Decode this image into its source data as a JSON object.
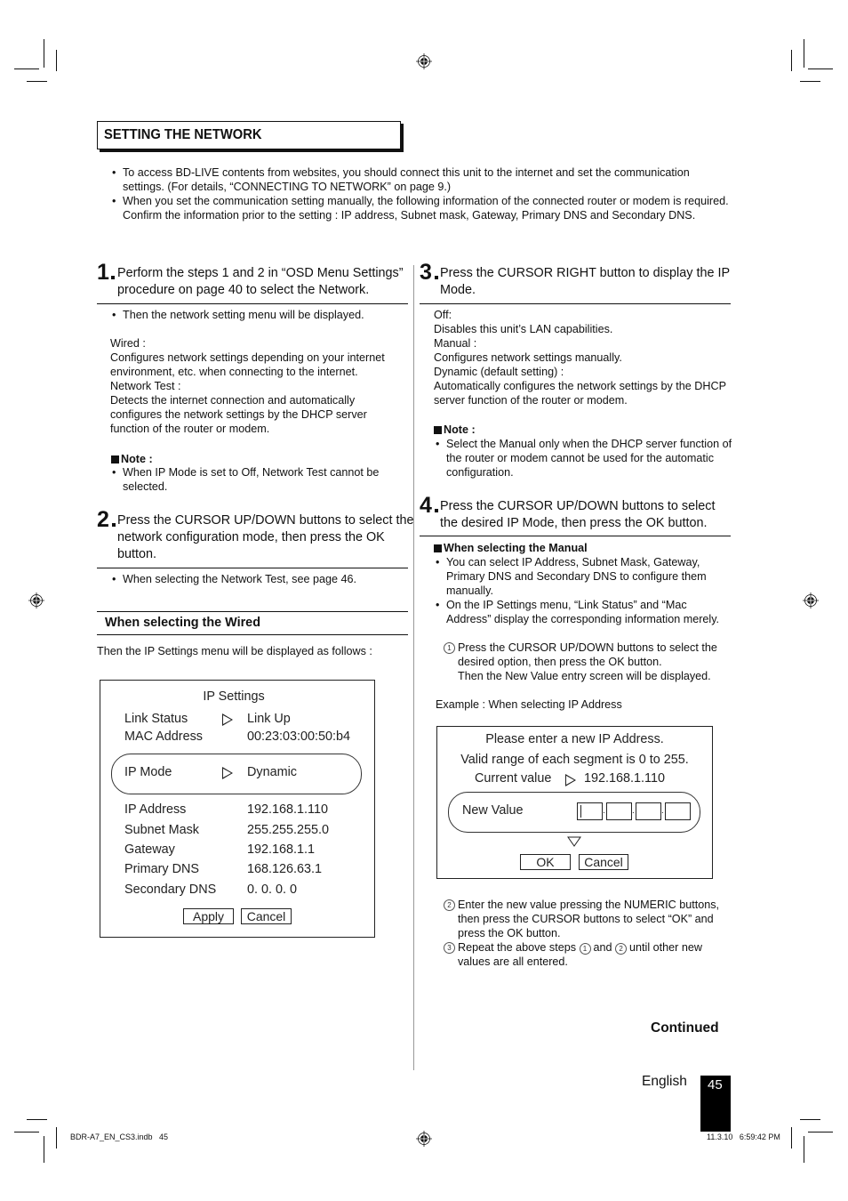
{
  "header": {
    "section_title": "SETTING THE NETWORK"
  },
  "intro": {
    "bullets": [
      "To access BD-LIVE contents from websites, you should connect this unit to the internet and set the communication settings. (For details, “CONNECTING TO NETWORK” on page 9.)",
      "When you set the communication setting manually, the following information of the connected router or modem is required. Confirm the information prior to the setting : IP address, Subnet mask, Gateway, Primary DNS and Secondary DNS."
    ]
  },
  "left_column": {
    "step1": {
      "number": "1",
      "text": "Perform the steps 1 and 2 in “OSD Menu Settings” procedure on page 40 to select the Network.",
      "bullet": "Then the network setting menu will be displayed.",
      "details": [
        "Wired :",
        "Configures network settings depending on your internet environment, etc. when connecting to the internet.",
        "Network Test :",
        "Detects the internet connection and automatically configures the network settings by the DHCP server function of the router or modem."
      ],
      "note_label": "Note :",
      "note_bullet": "When IP Mode is set to Off, Network Test cannot be selected."
    },
    "step2": {
      "number": "2",
      "text": "Press the CURSOR UP/DOWN buttons to select the network configuration mode, then press the OK button.",
      "bullet": "When selecting the Network Test, see page 46."
    },
    "wired_heading": "When selecting the Wired",
    "wired_intro": "Then the IP Settings menu will be displayed as follows :",
    "ip_settings": {
      "title": "IP Settings",
      "link_status_label": "Link Status",
      "link_status_value": "Link Up",
      "mac_label": "MAC Address",
      "mac_value": "00:23:03:00:50:b4",
      "ip_mode_label": "IP Mode",
      "ip_mode_value": "Dynamic",
      "fields": [
        {
          "label": "IP Address",
          "value": "192.168.1.110"
        },
        {
          "label": "Subnet Mask",
          "value": "255.255.255.0"
        },
        {
          "label": "Gateway",
          "value": "192.168.1.1"
        },
        {
          "label": "Primary DNS",
          "value": "168.126.63.1"
        },
        {
          "label": "Secondary DNS",
          "value": "0. 0. 0. 0"
        }
      ],
      "apply_label": "Apply",
      "cancel_label": "Cancel"
    }
  },
  "right_column": {
    "step3": {
      "number": "3",
      "text": "Press the CURSOR RIGHT button to display the IP Mode.",
      "details": [
        "Off:",
        "Disables this unit’s LAN capabilities.",
        "Manual :",
        "Configures network settings manually.",
        "Dynamic (default setting) :",
        "Automatically configures the network settings by the DHCP server function of the router or modem."
      ],
      "note_label": "Note :",
      "note_bullet": "Select the Manual only when the DHCP server function of the router or modem cannot be used for the automatic configuration."
    },
    "step4": {
      "number": "4",
      "text": "Press the CURSOR UP/DOWN buttons to select the desired IP Mode, then press the OK button.",
      "manual_heading": "When selecting the Manual",
      "bullets": [
        "You can select IP Address, Subnet Mask, Gateway, Primary DNS and Secondary DNS to configure them manually.",
        "On the IP Settings menu, “Link Status” and “Mac Address” display the corresponding information merely."
      ],
      "substep1": "Press the CURSOR UP/DOWN  buttons to select the desired option, then press the OK button.",
      "substep1b": "Then the New Value entry screen will be displayed.",
      "example": "Example : When selecting IP Address",
      "substep2": "Enter the new value pressing the NUMERIC buttons, then press the CURSOR buttons to select “OK” and press the OK button.",
      "substep3_a": "Repeat the above steps",
      "substep3_and": "and",
      "substep3_b": "until other new values are all entered.",
      "markers": [
        "1",
        "2",
        "3"
      ]
    },
    "new_value_dialog": {
      "line1": "Please enter a new IP Address.",
      "line2": "Valid range of each segment is 0 to 255.",
      "current_label": "Current value",
      "current_value": "192.168.1.110",
      "new_value_label": "New Value",
      "segments": [
        "",
        "",
        "",
        ""
      ],
      "ok_label": "OK",
      "cancel_label": "Cancel"
    },
    "continued": "Continued"
  },
  "footer": {
    "language": "English",
    "page_number": "45",
    "file_info": "BDR-A7_EN_CS3.indb   45",
    "timestamp": "11.3.10   6:59:42 PM"
  }
}
